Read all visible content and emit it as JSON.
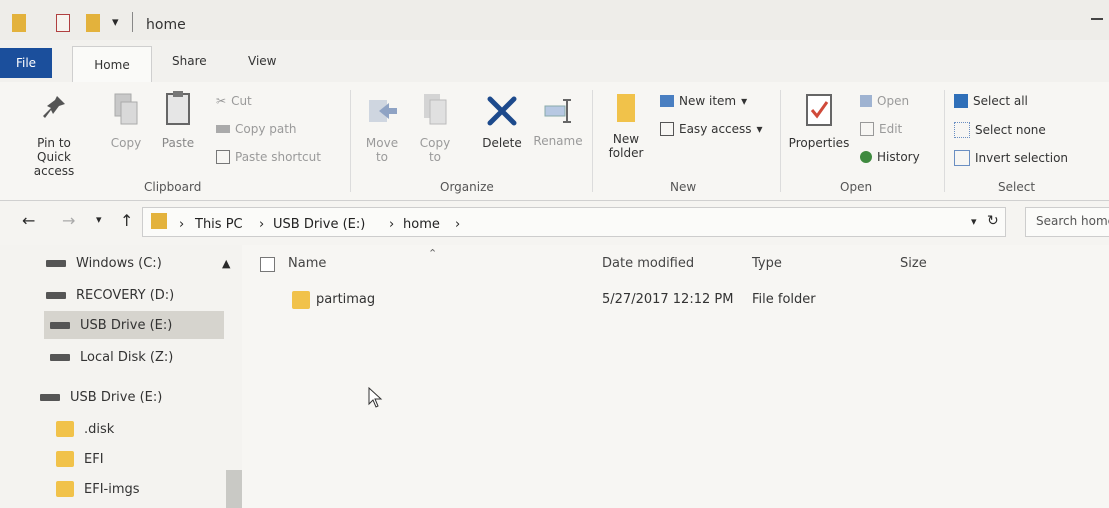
{
  "window": {
    "title": "home"
  },
  "tabs": [
    "File",
    "Home",
    "Share",
    "View"
  ],
  "ribbon": {
    "pin_to_quick_access": "Pin to Quick access",
    "copy": "Copy",
    "paste": "Paste",
    "cut": "Cut",
    "copy_path": "Copy path",
    "paste_shortcut": "Paste shortcut",
    "move_to": "Move to",
    "copy_to": "Copy to",
    "delete": "Delete",
    "rename": "Rename",
    "new_folder": "New folder",
    "new_item": "New item",
    "easy_access": "Easy access",
    "properties": "Properties",
    "open": "Open",
    "edit": "Edit",
    "history": "History",
    "select_all": "Select all",
    "select_none": "Select none",
    "invert_selection": "Invert selection",
    "groups": {
      "clipboard": "Clipboard",
      "organize": "Organize",
      "new": "New",
      "open": "Open",
      "select": "Select"
    }
  },
  "address": {
    "crumbs": [
      "This PC",
      "USB Drive (E:)",
      "home"
    ],
    "search_placeholder": "Search home"
  },
  "nav": {
    "items": [
      {
        "label": "Windows (C:)",
        "type": "drive"
      },
      {
        "label": "RECOVERY (D:)",
        "type": "drive"
      },
      {
        "label": "USB Drive (E:)",
        "type": "drive",
        "selected": true
      },
      {
        "label": "Local Disk (Z:)",
        "type": "drive"
      },
      {
        "label": "USB Drive (E:)",
        "type": "drive"
      },
      {
        "label": ".disk",
        "type": "folder"
      },
      {
        "label": "EFI",
        "type": "folder"
      },
      {
        "label": "EFI-imgs",
        "type": "folder"
      }
    ]
  },
  "list": {
    "columns": {
      "name": "Name",
      "date": "Date modified",
      "type": "Type",
      "size": "Size"
    },
    "rows": [
      {
        "name": "partimag",
        "date": "5/27/2017 12:12 PM",
        "type": "File folder",
        "size": ""
      }
    ]
  },
  "colors": {
    "folder": "#f1c24a",
    "file_tab": "#1b4f9c",
    "delete_x": "#1d4a8c"
  }
}
